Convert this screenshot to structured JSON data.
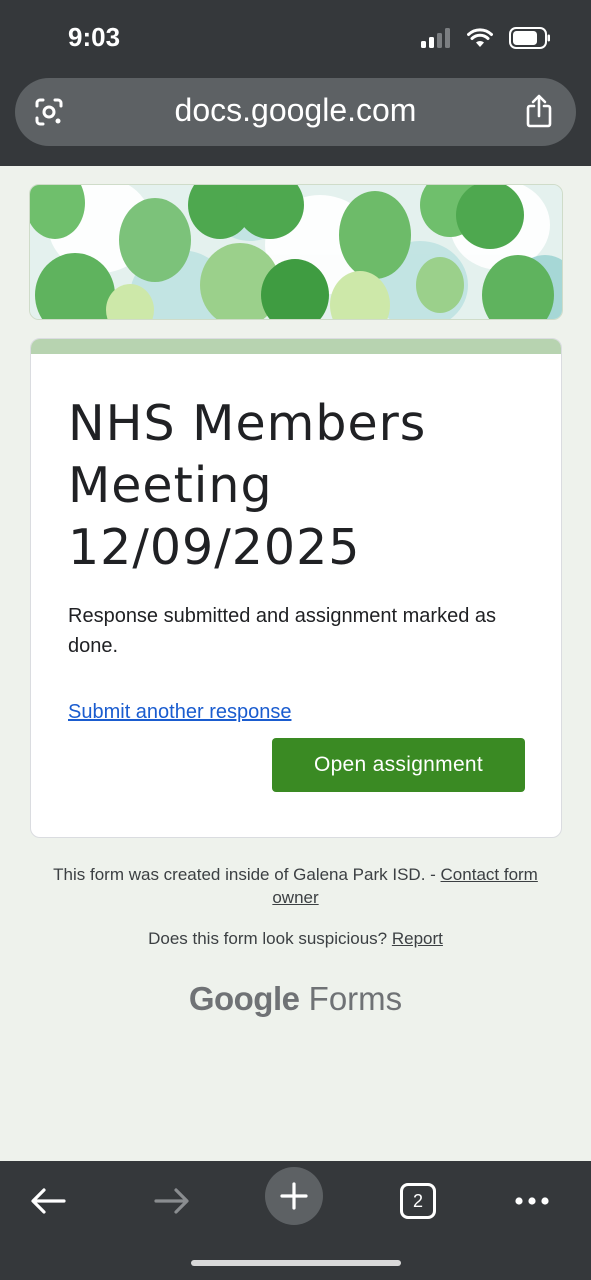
{
  "status_bar": {
    "time": "9:03"
  },
  "browser": {
    "url": "docs.google.com",
    "tab_count": "2"
  },
  "form": {
    "title_lines": [
      "NHS Members",
      "Meeting",
      "12/09/2025"
    ],
    "message": "Response submitted and assignment marked as done.",
    "submit_another_label": "Submit another response",
    "open_assignment_label": "Open assignment",
    "accent_color": "#3a8a23"
  },
  "footer": {
    "created_text": "This form was created inside of Galena Park ISD. - ",
    "contact_link": "Contact form owner",
    "suspicious_text": "Does this form look suspicious? ",
    "report_link": "Report",
    "brand_google": "Google",
    "brand_forms": "Forms"
  },
  "icons": {
    "lens": "google-lens-icon",
    "share": "share-icon",
    "back": "back-arrow-icon",
    "forward": "forward-arrow-icon",
    "new_tab": "plus-icon",
    "tabs": "tab-switcher-icon",
    "menu": "more-icon"
  }
}
